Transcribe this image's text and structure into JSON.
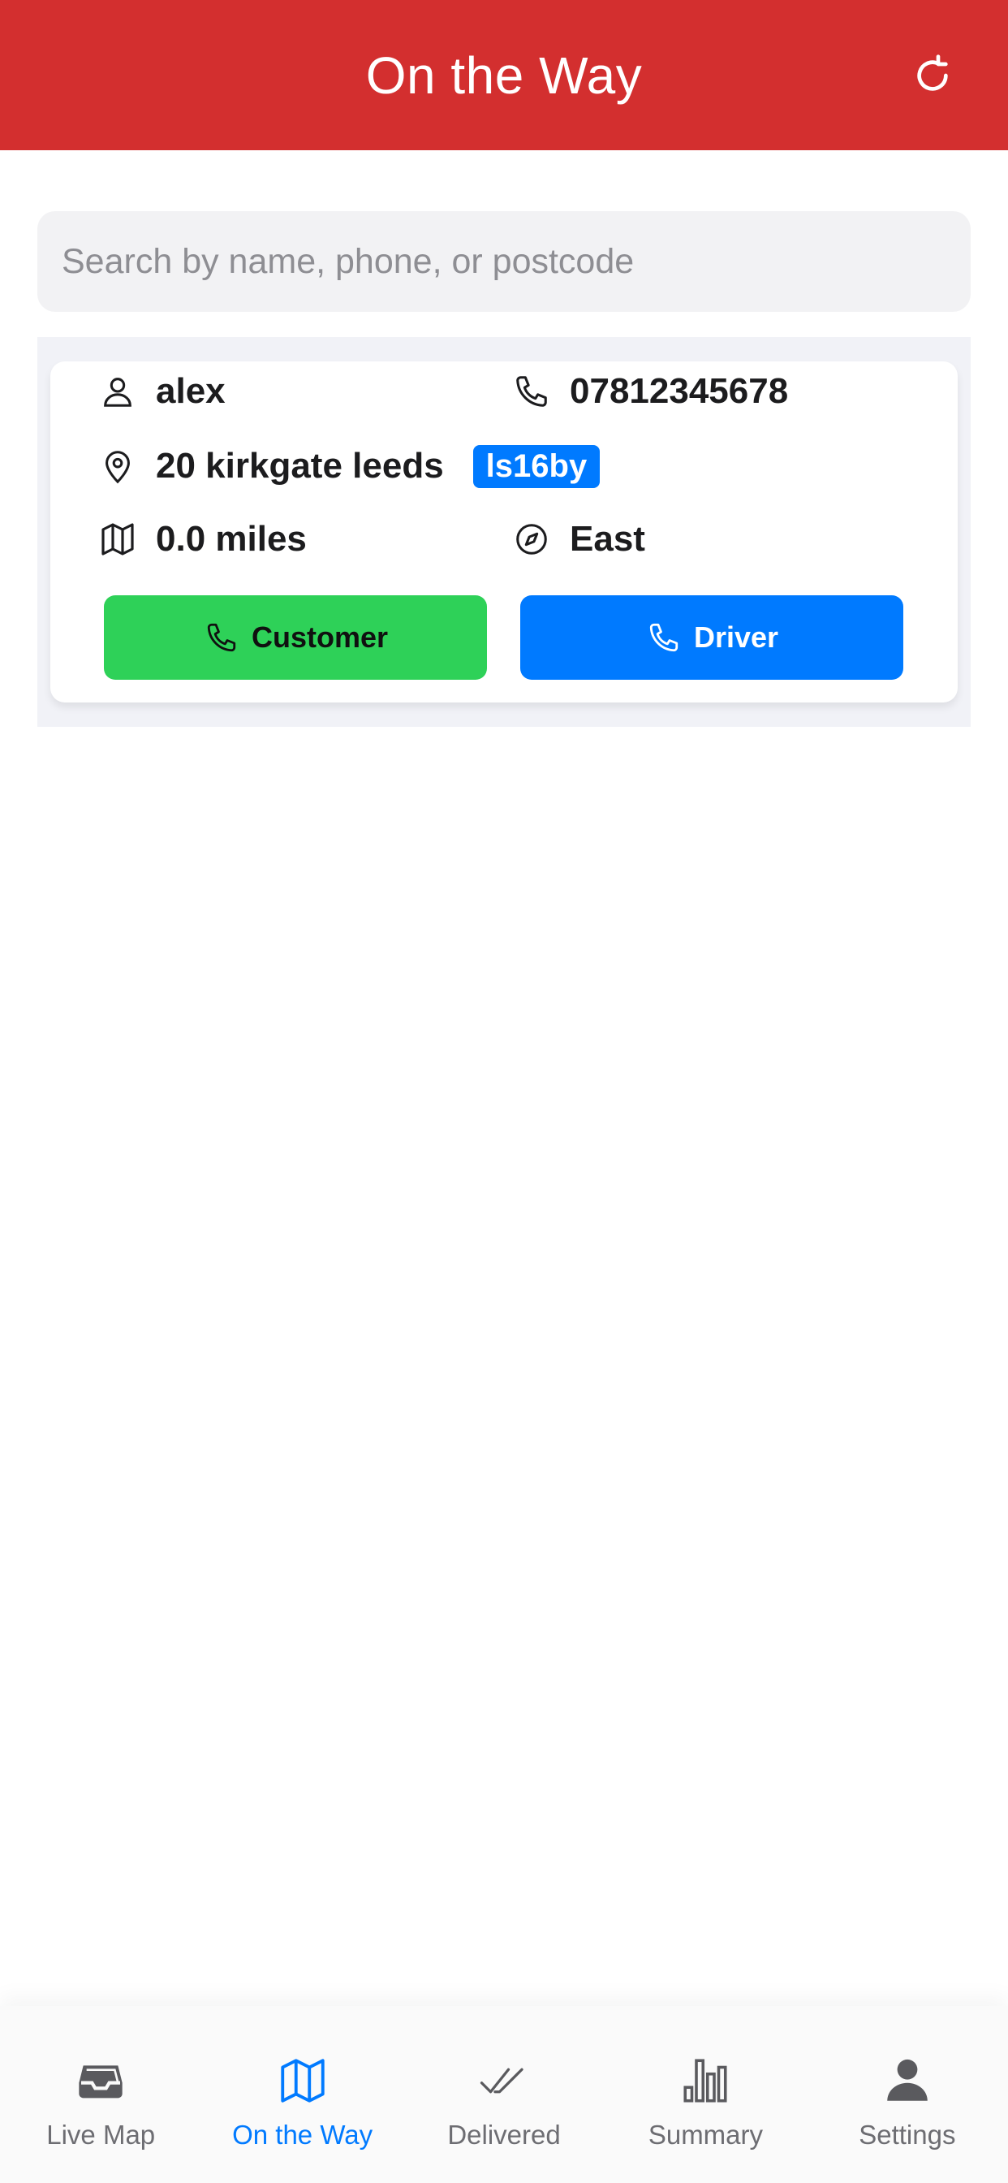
{
  "header": {
    "title": "On the Way",
    "refresh_icon": "refresh-icon",
    "background": "#d32f2f"
  },
  "search": {
    "placeholder": "Search by name, phone, or postcode",
    "value": ""
  },
  "orders": [
    {
      "name": "alex",
      "phone": "07812345678",
      "address": "20 kirkgate leeds",
      "postcode": "ls16by",
      "distance": "0.0 miles",
      "direction": "East",
      "customer_button": "Customer",
      "driver_button": "Driver"
    }
  ],
  "colors": {
    "customer_button": "#2ed158",
    "driver_button": "#007aff",
    "postcode_badge": "#007aff",
    "active_tab": "#007aff"
  },
  "tabs": [
    {
      "label": "Live Map",
      "icon": "inbox-tray-icon",
      "active": false
    },
    {
      "label": "On the Way",
      "icon": "map-icon",
      "active": true
    },
    {
      "label": "Delivered",
      "icon": "double-check-icon",
      "active": false
    },
    {
      "label": "Summary",
      "icon": "bar-chart-icon",
      "active": false
    },
    {
      "label": "Settings",
      "icon": "person-icon",
      "active": false
    }
  ]
}
